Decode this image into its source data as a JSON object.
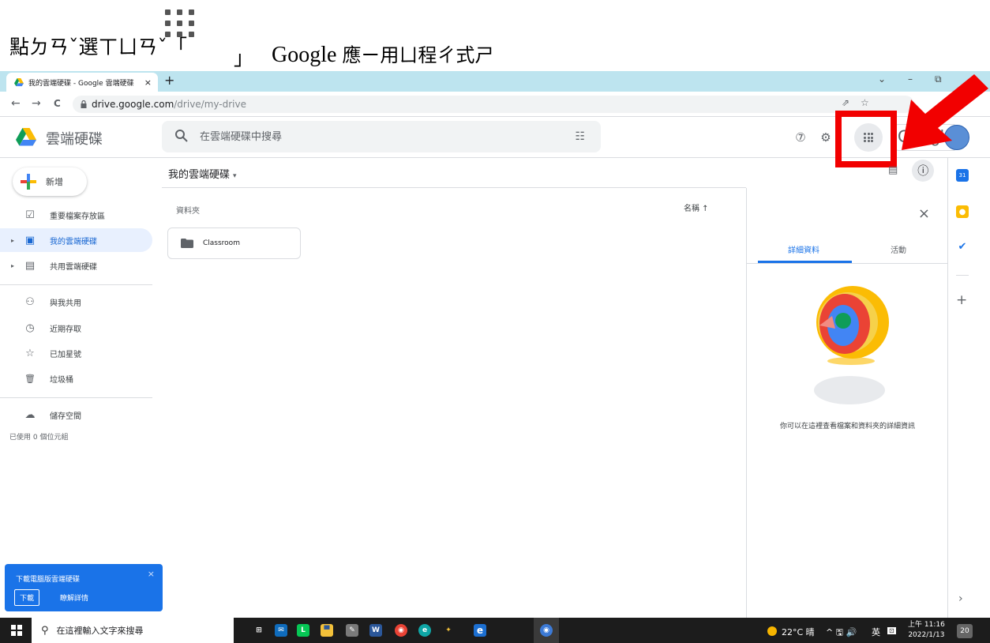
{
  "caption": {
    "prefix": "點ㄉㄢˇ選ㄒㄩㄢˇ「",
    "suffix": "」",
    "app_name": "Google",
    "app_suffix": "應ㄧ用ㄩ程ㄔ式ㄕ",
    "icon": "apps-grid-icon"
  },
  "browser": {
    "tab_title": "我的雲端硬碟 - Google 雲端硬碟",
    "tab_close": "×",
    "new_tab": "+",
    "url_host": "drive.google.com",
    "url_path": "/drive/my-drive",
    "back": "←",
    "forward": "→",
    "reload": "C",
    "window_menu": "⌄",
    "window_minimize": "–",
    "window_restore": "⧉",
    "share_icon": "⇗",
    "star_icon": "☆"
  },
  "header": {
    "product_name": "雲端硬碟",
    "search_placeholder": "在雲端硬碟中搜尋",
    "google_word": "Google",
    "help_glyph": "⑦",
    "settings_glyph": "⚙",
    "tune_glyph": "☷"
  },
  "sidebar": {
    "new_label": "新增",
    "items": [
      {
        "label": "重要檔案存放區",
        "icon": "checkbox-icon",
        "glyph": "☑"
      },
      {
        "label": "我的雲端硬碟",
        "icon": "my-drive-icon",
        "glyph": "▣"
      },
      {
        "label": "共用雲端硬碟",
        "icon": "shared-drive-icon",
        "glyph": "▤"
      },
      {
        "label": "與我共用",
        "icon": "people-icon",
        "glyph": "⚇"
      },
      {
        "label": "近期存取",
        "icon": "clock-icon",
        "glyph": "◷"
      },
      {
        "label": "已加星號",
        "icon": "star-icon",
        "glyph": "☆"
      },
      {
        "label": "垃圾桶",
        "icon": "trash-icon",
        "glyph": "🗑"
      },
      {
        "label": "儲存空間",
        "icon": "cloud-icon",
        "glyph": "☁"
      }
    ],
    "storage_used": "已使用 0 個位元組",
    "expand_glyph": "▸",
    "toast": {
      "title": "下載電腦版雲端硬碟",
      "download": "下載",
      "learn_more": "瞭解詳情",
      "close": "×"
    }
  },
  "main": {
    "title": "我的雲端硬碟",
    "title_caret": "▾",
    "folders_label": "資料夾",
    "sort_label": "名稱 ↑",
    "folders": [
      {
        "name": "Classroom"
      }
    ]
  },
  "details": {
    "close": "×",
    "tab_details": "詳細資料",
    "tab_activity": "活動",
    "empty_message": "你可以在這裡查看檔案和資料夾的詳細資訊",
    "list_view_glyph": "▤",
    "info_glyph": "ⓘ"
  },
  "rail": {
    "calendar_day": "31",
    "keep_glyph": "●",
    "tasks_glyph": "✔",
    "add_glyph": "+",
    "expand_glyph": "›"
  },
  "taskbar": {
    "search_placeholder": "在這裡輸入文字來搜尋",
    "weather": "22°C 晴",
    "tray_icons": "^ 🖫 🔊",
    "ime": "英",
    "clock_time": "上午 11:16",
    "clock_date": "2022/1/13",
    "notification_count": "20",
    "search_glyph": "⚲",
    "apps": [
      {
        "name": "task-view",
        "color": "#1c1c1c",
        "glyph": "⊞"
      },
      {
        "name": "mail",
        "color": "#0f6cbd",
        "glyph": "✉"
      },
      {
        "name": "line",
        "color": "#06c755",
        "glyph": "L"
      },
      {
        "name": "file-explorer",
        "color": "#f3c13a",
        "glyph": "▀"
      },
      {
        "name": "paint",
        "color": "#7a7a7a",
        "glyph": "✎"
      },
      {
        "name": "word",
        "color": "#2b579a",
        "glyph": "W"
      },
      {
        "name": "chrome",
        "color": "#ea4335",
        "glyph": "◉"
      },
      {
        "name": "edge",
        "color": "#0fa6a6",
        "glyph": "e"
      },
      {
        "name": "pin-app",
        "color": "#1c1c1c",
        "glyph": "✦"
      },
      {
        "name": "internet-explorer",
        "color": "#1c6fd1",
        "glyph": "e"
      },
      {
        "name": "chrome-profile",
        "color": "#3c7ad6",
        "glyph": "◉"
      }
    ]
  },
  "colors": {
    "accent": "#1a73e8",
    "tab_strip": "#bde4ef",
    "highlight_red": "#f20000",
    "toast_bg": "#1a73e8"
  }
}
